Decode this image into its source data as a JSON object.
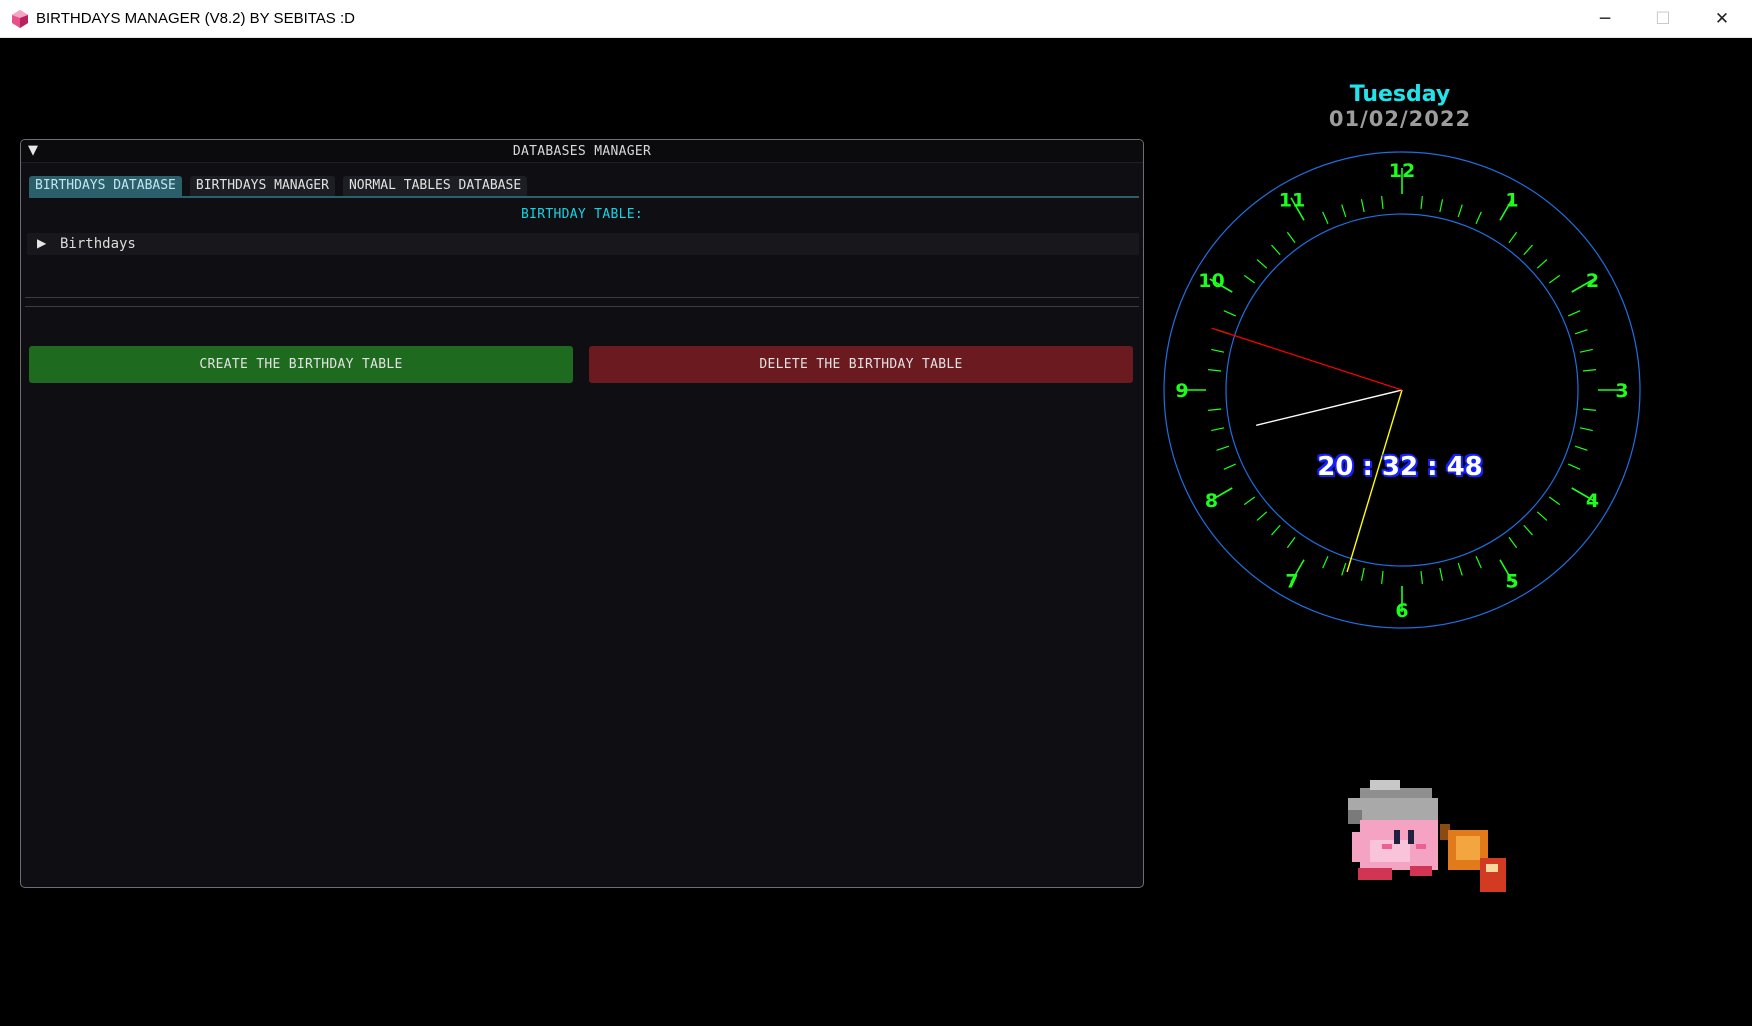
{
  "window": {
    "title": "BIRTHDAYS MANAGER (V8.2) BY SEBITAS :D",
    "icon": "pink-gem-icon",
    "controls": {
      "minimize": "─",
      "maximize": "☐",
      "close": "✕"
    }
  },
  "panel": {
    "collapse_glyph": "▼",
    "title": "DATABASES MANAGER",
    "tabs": [
      {
        "label": "BIRTHDAYS DATABASE",
        "active": true
      },
      {
        "label": "BIRTHDAYS MANAGER",
        "active": false
      },
      {
        "label": "NORMAL TABLES DATABASE",
        "active": false
      }
    ],
    "section_label": "BIRTHDAY TABLE:",
    "tree": {
      "arrow": "▶",
      "label": "Birthdays"
    },
    "buttons": {
      "create": "CREATE THE BIRTHDAY TABLE",
      "delete": "DELETE THE BIRTHDAY TABLE"
    }
  },
  "clock": {
    "day": "Tuesday",
    "date": "01/02/2022",
    "time": "20 : 32 : 48",
    "numbers": [
      "12",
      "1",
      "2",
      "3",
      "4",
      "5",
      "6",
      "7",
      "8",
      "9",
      "10",
      "11"
    ],
    "hour": 20,
    "minute": 32,
    "second": 48,
    "colors": {
      "numbers": "#1cff1c",
      "ticks": "#1cff1c",
      "ring": "#1e6fe0",
      "hour_hand": "#ffffff",
      "minute_hand": "#ffff00",
      "second_hand": "#ff0000"
    }
  },
  "mascot": {
    "icon": "kirby-hammer-icon"
  },
  "colors": {
    "accent": "#15d4e2",
    "create": "#1e6b1f",
    "delete": "#6b1a1f",
    "tab_active": "#2c5f6c"
  }
}
